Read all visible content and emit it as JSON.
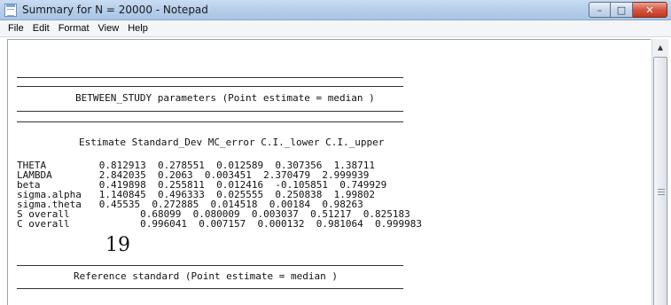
{
  "window": {
    "title": "Summary for N = 20000  - Notepad",
    "controls": {
      "minimize": "–",
      "maximize": "□",
      "close": "✕"
    }
  },
  "menu": {
    "items": [
      "File",
      "Edit",
      "Format",
      "View",
      "Help"
    ]
  },
  "document": {
    "between_heading": "BETWEEN_STUDY parameters (Point estimate = median )",
    "columns_header": "Estimate Standard_Dev MC_error C.I._lower C.I._upper",
    "rows": [
      "THETA         0.812913  0.278551  0.012589  0.307356  1.38711",
      "LAMBDA        2.842035  0.2063  0.003451  2.370479  2.999939",
      "beta          0.419898  0.255811  0.012416  -0.105851  0.749929",
      "sigma.alpha   1.140845  0.496333  0.025555  0.250838  1.99802",
      "sigma.theta   0.45535  0.272885  0.014518  0.00184  0.98263",
      "S overall            0.68099  0.080009  0.003037  0.51217  0.825183",
      "C overall            0.996041  0.007157  0.000132  0.981064  0.999983"
    ],
    "page_number": "19",
    "reference_heading": "Reference standard (Point estimate = median )"
  },
  "scrollbar": {
    "up_arrow": "▲",
    "thumb_grip": "grip-icon"
  }
}
